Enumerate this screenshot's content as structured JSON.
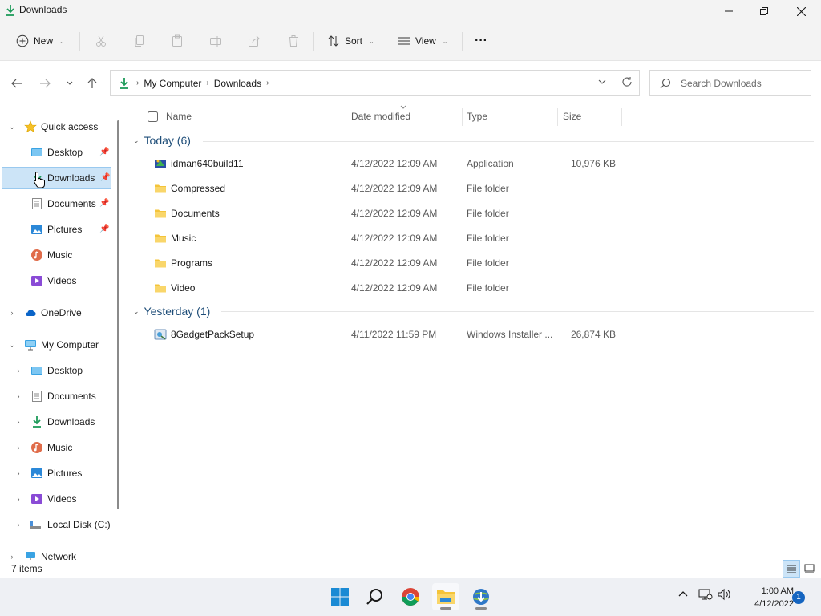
{
  "window": {
    "title": "Downloads"
  },
  "commandbar": {
    "new_label": "New",
    "sort_label": "Sort",
    "view_label": "View",
    "more_label": "···"
  },
  "address": {
    "crumbs": [
      "My Computer",
      "Downloads"
    ],
    "search_placeholder": "Search Downloads"
  },
  "sidebar": {
    "quick_access": "Quick access",
    "quick_items": [
      "Desktop",
      "Downloads",
      "Documents",
      "Pictures",
      "Music",
      "Videos"
    ],
    "onedrive": "OneDrive",
    "my_computer": "My Computer",
    "computer_items": [
      "Desktop",
      "Documents",
      "Downloads",
      "Music",
      "Pictures",
      "Videos",
      "Local Disk (C:)"
    ],
    "network": "Network"
  },
  "columns": {
    "name": "Name",
    "date": "Date modified",
    "type": "Type",
    "size": "Size"
  },
  "groups": {
    "today": "Today (6)",
    "yesterday": "Yesterday (1)"
  },
  "files": [
    {
      "name": "idman640build11",
      "date": "4/12/2022 12:09 AM",
      "type": "Application",
      "size": "10,976 KB",
      "icon": "installer-app-icon"
    },
    {
      "name": "Compressed",
      "date": "4/12/2022 12:09 AM",
      "type": "File folder",
      "size": "",
      "icon": "folder-icon"
    },
    {
      "name": "Documents",
      "date": "4/12/2022 12:09 AM",
      "type": "File folder",
      "size": "",
      "icon": "folder-icon"
    },
    {
      "name": "Music",
      "date": "4/12/2022 12:09 AM",
      "type": "File folder",
      "size": "",
      "icon": "folder-icon"
    },
    {
      "name": "Programs",
      "date": "4/12/2022 12:09 AM",
      "type": "File folder",
      "size": "",
      "icon": "folder-icon"
    },
    {
      "name": "Video",
      "date": "4/12/2022 12:09 AM",
      "type": "File folder",
      "size": "",
      "icon": "folder-icon"
    },
    {
      "name": "8GadgetPackSetup",
      "date": "4/11/2022 11:59 PM",
      "type": "Windows Installer ...",
      "size": "26,874 KB",
      "icon": "msi-installer-icon"
    }
  ],
  "status": {
    "items": "7 items"
  },
  "taskbar": {
    "time": "1:00 AM",
    "date": "4/12/2022",
    "notifications": "1"
  },
  "colors": {
    "accent": "#0078d4",
    "group_header": "#1f4e79",
    "selection": "#cce4f7",
    "folder": "#f4c43a"
  }
}
